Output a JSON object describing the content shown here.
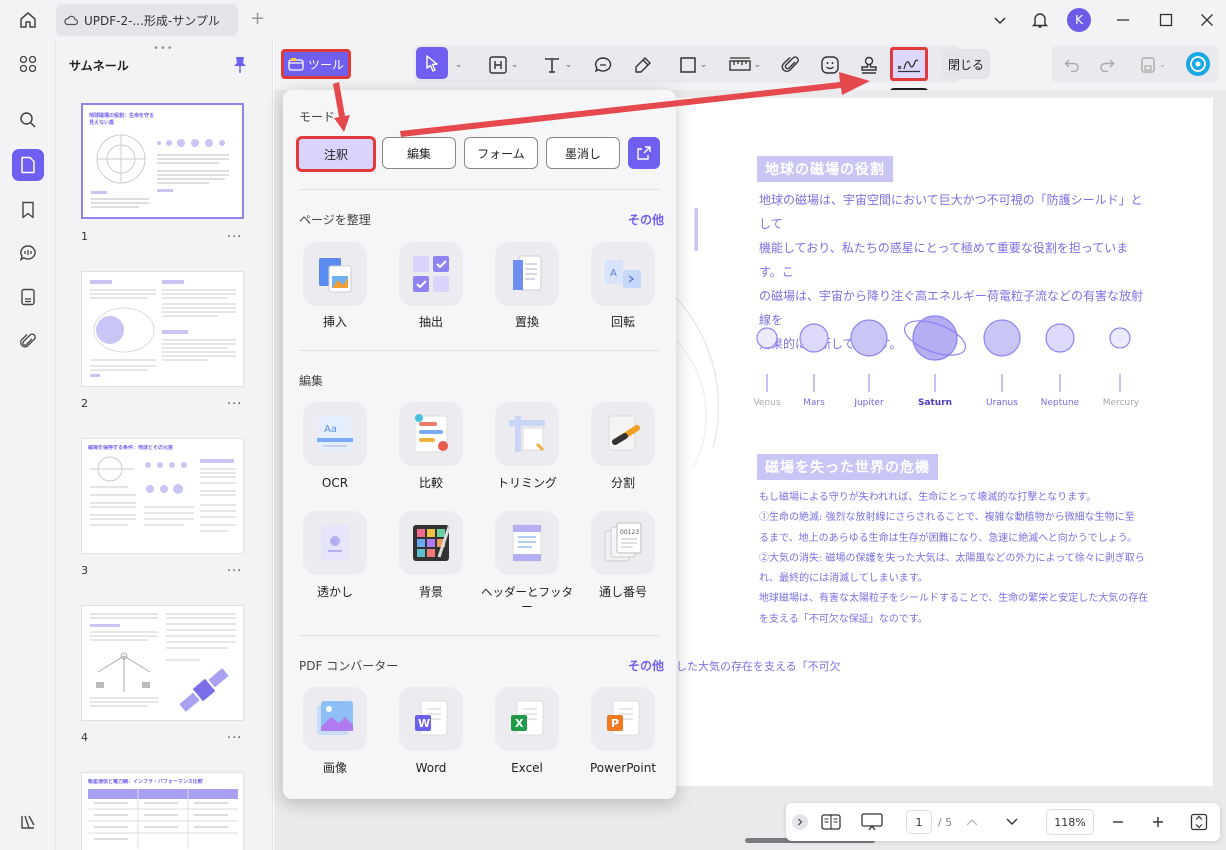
{
  "titlebar": {
    "tab_title": "UPDF-2-...形成-サンプル",
    "tab_add": "+",
    "avatar_letter": "K"
  },
  "thumbnails": {
    "title": "サムネール",
    "pages": [
      {
        "num": "1",
        "menu": "..."
      },
      {
        "num": "2",
        "menu": "..."
      },
      {
        "num": "3",
        "menu": "..."
      },
      {
        "num": "4",
        "menu": "..."
      }
    ],
    "texts": {
      "p1_title": "地球磁場の役割：生命を守る見えない盾",
      "p3_title": "磁場を保持する条件：地球とその兄弟",
      "p5_title": "衛星通信と電力網：インフラ・パフォーマンス比較"
    }
  },
  "toolbar": {
    "tools_label": "ツール",
    "close_label": "閉じる",
    "tooltip": "署名"
  },
  "dropdown": {
    "mode_title": "モード",
    "modes": [
      "注釈",
      "編集",
      "フォーム",
      "墨消し"
    ],
    "organize": {
      "title": "ページを整理",
      "more": "その他",
      "items": [
        "挿入",
        "抽出",
        "置換",
        "回転"
      ]
    },
    "edit": {
      "title": "編集",
      "items": [
        "OCR",
        "比較",
        "トリミング",
        "分割",
        "透かし",
        "背景",
        "ヘッダーとフッター",
        "通し番号"
      ]
    },
    "converter": {
      "title": "PDF コンバーター",
      "more": "その他",
      "items": [
        "画像",
        "Word",
        "Excel",
        "PowerPoint"
      ]
    }
  },
  "document": {
    "heading1": "地球の磁場の役割",
    "para1": [
      "地球の磁場は、宇宙空間において巨大かつ不可視の「防護シールド」として",
      "機能しており、私たちの惑星にとって極めて重要な役割を担っています。こ",
      "の磁場は、宇宙から降り注ぐ高エネルギー荷電粒子流などの有害な放射線を",
      "効果的に遮断しています。"
    ],
    "planets": [
      "Venus",
      "Mars",
      "Jupiter",
      "Saturn",
      "Uranus",
      "Neptune",
      "Mercury"
    ],
    "heading2": "磁場を失った世界の危機",
    "para2": [
      "もし磁場による守りが失われれば、生命にとって壊滅的な打撃となります。",
      "①生命の絶滅: 強烈な放射線にさらされることで、複雑な動植物から微細な生物に至",
      "るまで、地上のあらゆる生命は生存が困難になり、急速に絶滅へと向かうでしょう。",
      "②大気の消失: 磁場の保護を失った大気は、太陽風などの外力によって徐々に剥ぎ取ら",
      "れ、最終的には消滅してしまいます。",
      "地球磁場は、有害な太陽粒子をシールドすることで、生命の繁栄と安定した大気の存在",
      "を支える「不可欠な保証」なのです。"
    ],
    "partial_line": "した大気の存在を支える「不可欠"
  },
  "statusbar": {
    "page_current": "1",
    "page_total": "/ 5",
    "zoom": "118%"
  },
  "colors": {
    "accent": "#6f5ff0",
    "highlight_red": "#e23a3a",
    "doc_text": "#7b70e3"
  }
}
